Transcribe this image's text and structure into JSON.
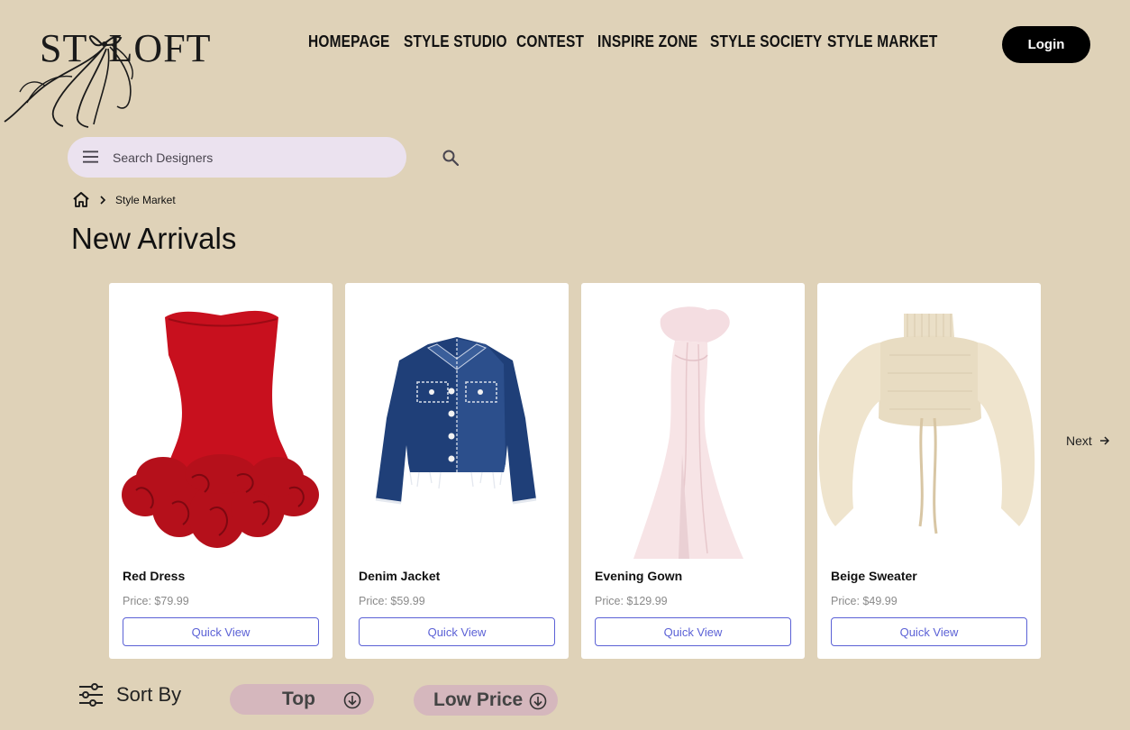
{
  "brand": {
    "logo_text": "ST  LOFT"
  },
  "nav": {
    "items": [
      "HOMEPAGE",
      "STYLE STUDIO",
      "CONTEST",
      "INSPIRE ZONE",
      "STYLE SOCIETY",
      "STYLE MARKET"
    ],
    "login_label": "Login"
  },
  "search": {
    "placeholder": "Search Designers",
    "value": ""
  },
  "breadcrumb": {
    "current": "Style Market"
  },
  "page_title": "New Arrivals",
  "products": [
    {
      "name": "Red Dress",
      "price": "Price: $79.99",
      "action": "Quick View"
    },
    {
      "name": "Denim Jacket",
      "price": "Price: $59.99",
      "action": "Quick View"
    },
    {
      "name": "Evening Gown",
      "price": "Price: $129.99",
      "action": "Quick View"
    },
    {
      "name": "Beige Sweater",
      "price": "Price: $49.99",
      "action": "Quick View"
    }
  ],
  "pager": {
    "next_label": "Next"
  },
  "sort": {
    "label": "Sort By",
    "options": [
      "Top",
      "Low Price"
    ]
  },
  "colors": {
    "background": "#dfd2b8",
    "accent": "#5b61d6",
    "pill": "#d5b7bd",
    "search_bg": "#ebe2ef"
  }
}
